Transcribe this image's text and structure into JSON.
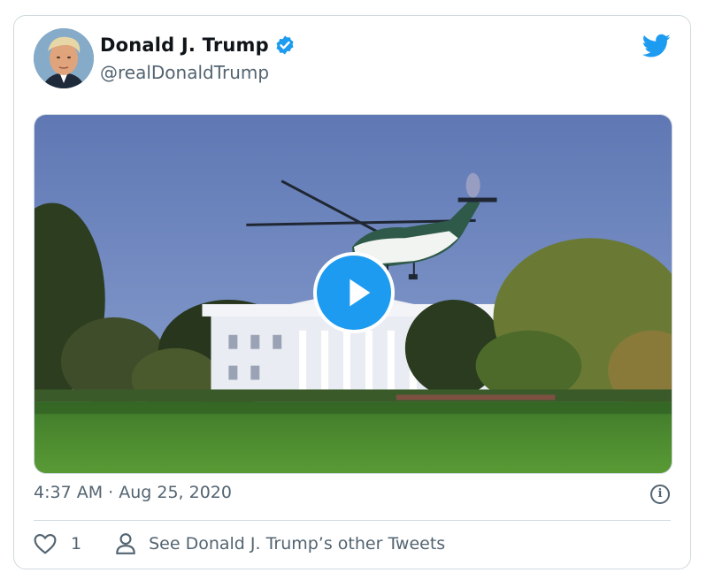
{
  "tweet": {
    "display_name": "Donald J. Trump",
    "handle": "@realDonaldTrump",
    "verified": true,
    "timestamp": "4:37 AM · Aug 25, 2020",
    "like_count": "1",
    "other_tweets_label": "See Donald J. Trump’s other Tweets"
  },
  "icons": {
    "verified": "verified-badge-icon",
    "brand": "twitter-bird-icon",
    "play": "play-icon",
    "info": "info-icon",
    "like": "heart-icon",
    "profile": "person-icon"
  },
  "colors": {
    "accent": "#1d9bf0",
    "text_primary": "#0f1419",
    "text_secondary": "#536471",
    "border": "#cfd9de"
  }
}
